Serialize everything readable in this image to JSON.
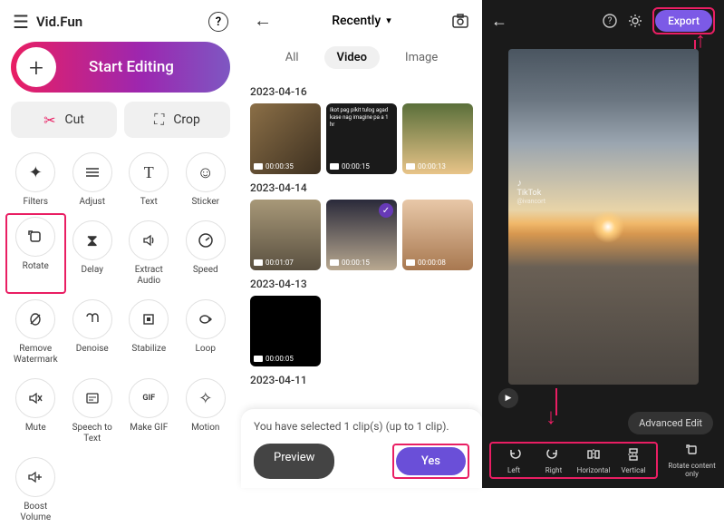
{
  "panel1": {
    "app_name": "Vid.Fun",
    "start_editing": "Start Editing",
    "cut_label": "Cut",
    "crop_label": "Crop",
    "tools": [
      {
        "label": "Filters",
        "icon": "✦"
      },
      {
        "label": "Adjust",
        "icon": "≡"
      },
      {
        "label": "Text",
        "icon": "T"
      },
      {
        "label": "Sticker",
        "icon": "☺"
      },
      {
        "label": "Rotate",
        "icon": "◐",
        "highlight": true
      },
      {
        "label": "Delay",
        "icon": "⧗"
      },
      {
        "label": "Extract Audio",
        "icon": "🔊"
      },
      {
        "label": "Speed",
        "icon": "◔"
      },
      {
        "label": "Remove Watermark",
        "icon": "◇"
      },
      {
        "label": "Denoise",
        "icon": "∩∩"
      },
      {
        "label": "Stabilize",
        "icon": "⊡"
      },
      {
        "label": "Loop",
        "icon": "↻"
      },
      {
        "label": "Mute",
        "icon": "🔇"
      },
      {
        "label": "Speech to Text",
        "icon": "⊞"
      },
      {
        "label": "Make GIF",
        "icon": "GIF"
      },
      {
        "label": "Motion",
        "icon": "✧"
      },
      {
        "label": "Boost Volume",
        "icon": "🔊+"
      }
    ]
  },
  "panel2": {
    "recently_label": "Recently",
    "tabs": {
      "all": "All",
      "video": "Video",
      "image": "Image"
    },
    "dates": {
      "d1": "2023-04-16",
      "d2": "2023-04-14",
      "d3": "2023-04-13",
      "d4": "2023-04-11"
    },
    "times": {
      "t1": "00:00:35",
      "t2": "00:00:15",
      "t3": "00:00:13",
      "t4": "00:01:07",
      "t5": "00:00:15",
      "t6": "00:00:08",
      "t7": "00:00:05"
    },
    "thumb2_text": "Ikot pag pikit tulog agad kase nag imagine pa a 1 hr",
    "sheet_text": "You have selected 1 clip(s) (up to 1 clip).",
    "preview_label": "Preview",
    "yes_label": "Yes"
  },
  "panel3": {
    "export_label": "Export",
    "tiktok_brand": "TikTok",
    "tiktok_user": "@ivancort",
    "advanced_edit": "Advanced Edit",
    "rotate_items": {
      "left": "Left",
      "right": "Right",
      "horizontal": "Horizontal",
      "vertical": "Vertical"
    },
    "rotate_only": "Rotate content only"
  }
}
